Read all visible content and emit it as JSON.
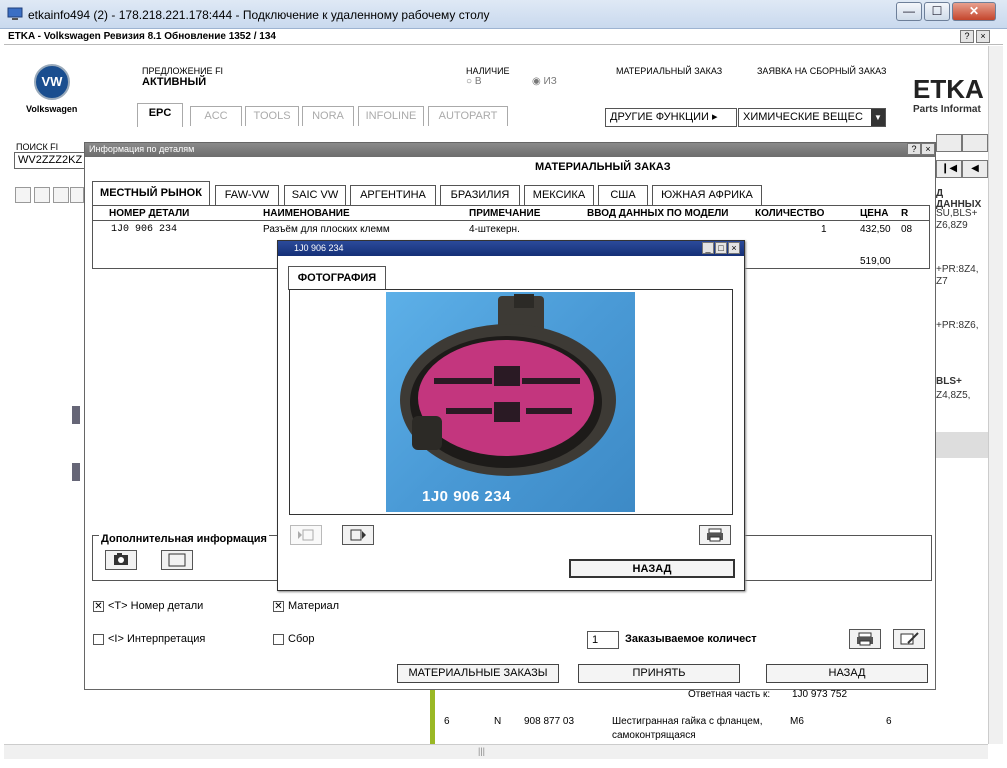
{
  "rdp": {
    "title": "etkainfo494 (2) - 178.218.221.178:444 - Подключение к удаленному рабочему столу",
    "min": "—",
    "max": "☐",
    "close": "✕"
  },
  "etka": {
    "title": "ETKA - Volkswagen Ревизия 8.1 Обновление 1352 / 134",
    "help": "?",
    "close": "×"
  },
  "header": {
    "vw_logo": "VW",
    "brand": "Volkswagen",
    "offer_label": "ПРЕДЛОЖЕНИЕ FI",
    "offer_value": "АКТИВНЫЙ",
    "stock_label": "НАЛИЧИЕ",
    "stock_opt_b": "В",
    "stock_opt_iz": "ИЗ",
    "material_order_label": "МАТЕРИАЛЬНЫЙ ЗАКАЗ",
    "assembly_order_label": "ЗАЯВКА НА СБОРНЫЙ ЗАКАЗ",
    "etka_logo": "ETKA",
    "etka_sub": "Parts Informat",
    "tabs": [
      "EPC",
      "ACC",
      "TOOLS",
      "NORA",
      "INFOLINE",
      "AUTOPART"
    ],
    "other_functions": "ДРУГИЕ ФУНКЦИИ ▸",
    "chemicals": "ХИМИЧЕСКИЕ ВЕЩЕС"
  },
  "search": {
    "label": "ПОИСК FI",
    "value": "WV2ZZZ2KZ"
  },
  "background_right": {
    "data_label": "Д ДАННЫХ",
    "line1": "SU,BLS+",
    "line2": "Z6,8Z9",
    "line3": "+PR:8Z4,",
    "line4": "Z7",
    "line5": "+PR:8Z6,",
    "line6": "BLS+",
    "line7": "Z4,8Z5,"
  },
  "bottom": {
    "response_label": "Ответная часть к:",
    "response_value": "1J0 973 752",
    "row_no": "6",
    "row_marker": "N",
    "row_part": "908 877 03",
    "row_desc1": "Шестигранная гайка с фланцем,",
    "row_desc2": "самоконтрящаяся",
    "row_spec": "M6",
    "row_qty": "6"
  },
  "dialog": {
    "title": "Информация по деталям",
    "help": "?",
    "close": "×",
    "heading": "МАТЕРИАЛЬНЫЙ ЗАКАЗ",
    "tabs": [
      "МЕСТНЫЙ РЫНОК",
      "FAW-VW",
      "SAIC VW",
      "АРГЕНТИНА",
      "БРАЗИЛИЯ",
      "МЕКСИКА",
      "США",
      "ЮЖНАЯ АФРИКА"
    ],
    "columns": {
      "part": "НОМЕР ДЕТАЛИ",
      "name": "НАИМЕНОВАНИЕ",
      "note": "ПРИМЕЧАНИЕ",
      "model": "ВВОД ДАННЫХ ПО МОДЕЛИ",
      "qty": "КОЛИЧЕСТВО",
      "price": "ЦЕНА",
      "r": "R"
    },
    "row": {
      "part": "1J0 906 234",
      "name": "Разъём для плоских клемм",
      "note": "4-штекерн.",
      "qty": "1",
      "price": "432,50",
      "r": "08",
      "total": "519,00"
    },
    "additional_info": "Дополнительная информация",
    "chk_part_number": "<T> Номер детали",
    "chk_material": "Материал",
    "chk_interpretation": "<I> Интерпретация",
    "chk_assembly": "Сбор",
    "order_qty_value": "1",
    "order_qty_label": "Заказываемое количест",
    "btn_material_orders": "МАТЕРИАЛЬНЫЕ ЗАКАЗЫ",
    "btn_accept": "ПРИНЯТЬ",
    "btn_back": "НАЗАД"
  },
  "photo": {
    "title": "1J0 906 234",
    "tab": "ФОТОГРАФИЯ",
    "image_caption": "1J0 906 234",
    "btn_back": "НАЗАД"
  },
  "colors": {
    "connector_body": "#3d3a35",
    "connector_face": "#c3367e",
    "photo_bg": "#4a9ad6",
    "accent_green": "#9ab825"
  }
}
